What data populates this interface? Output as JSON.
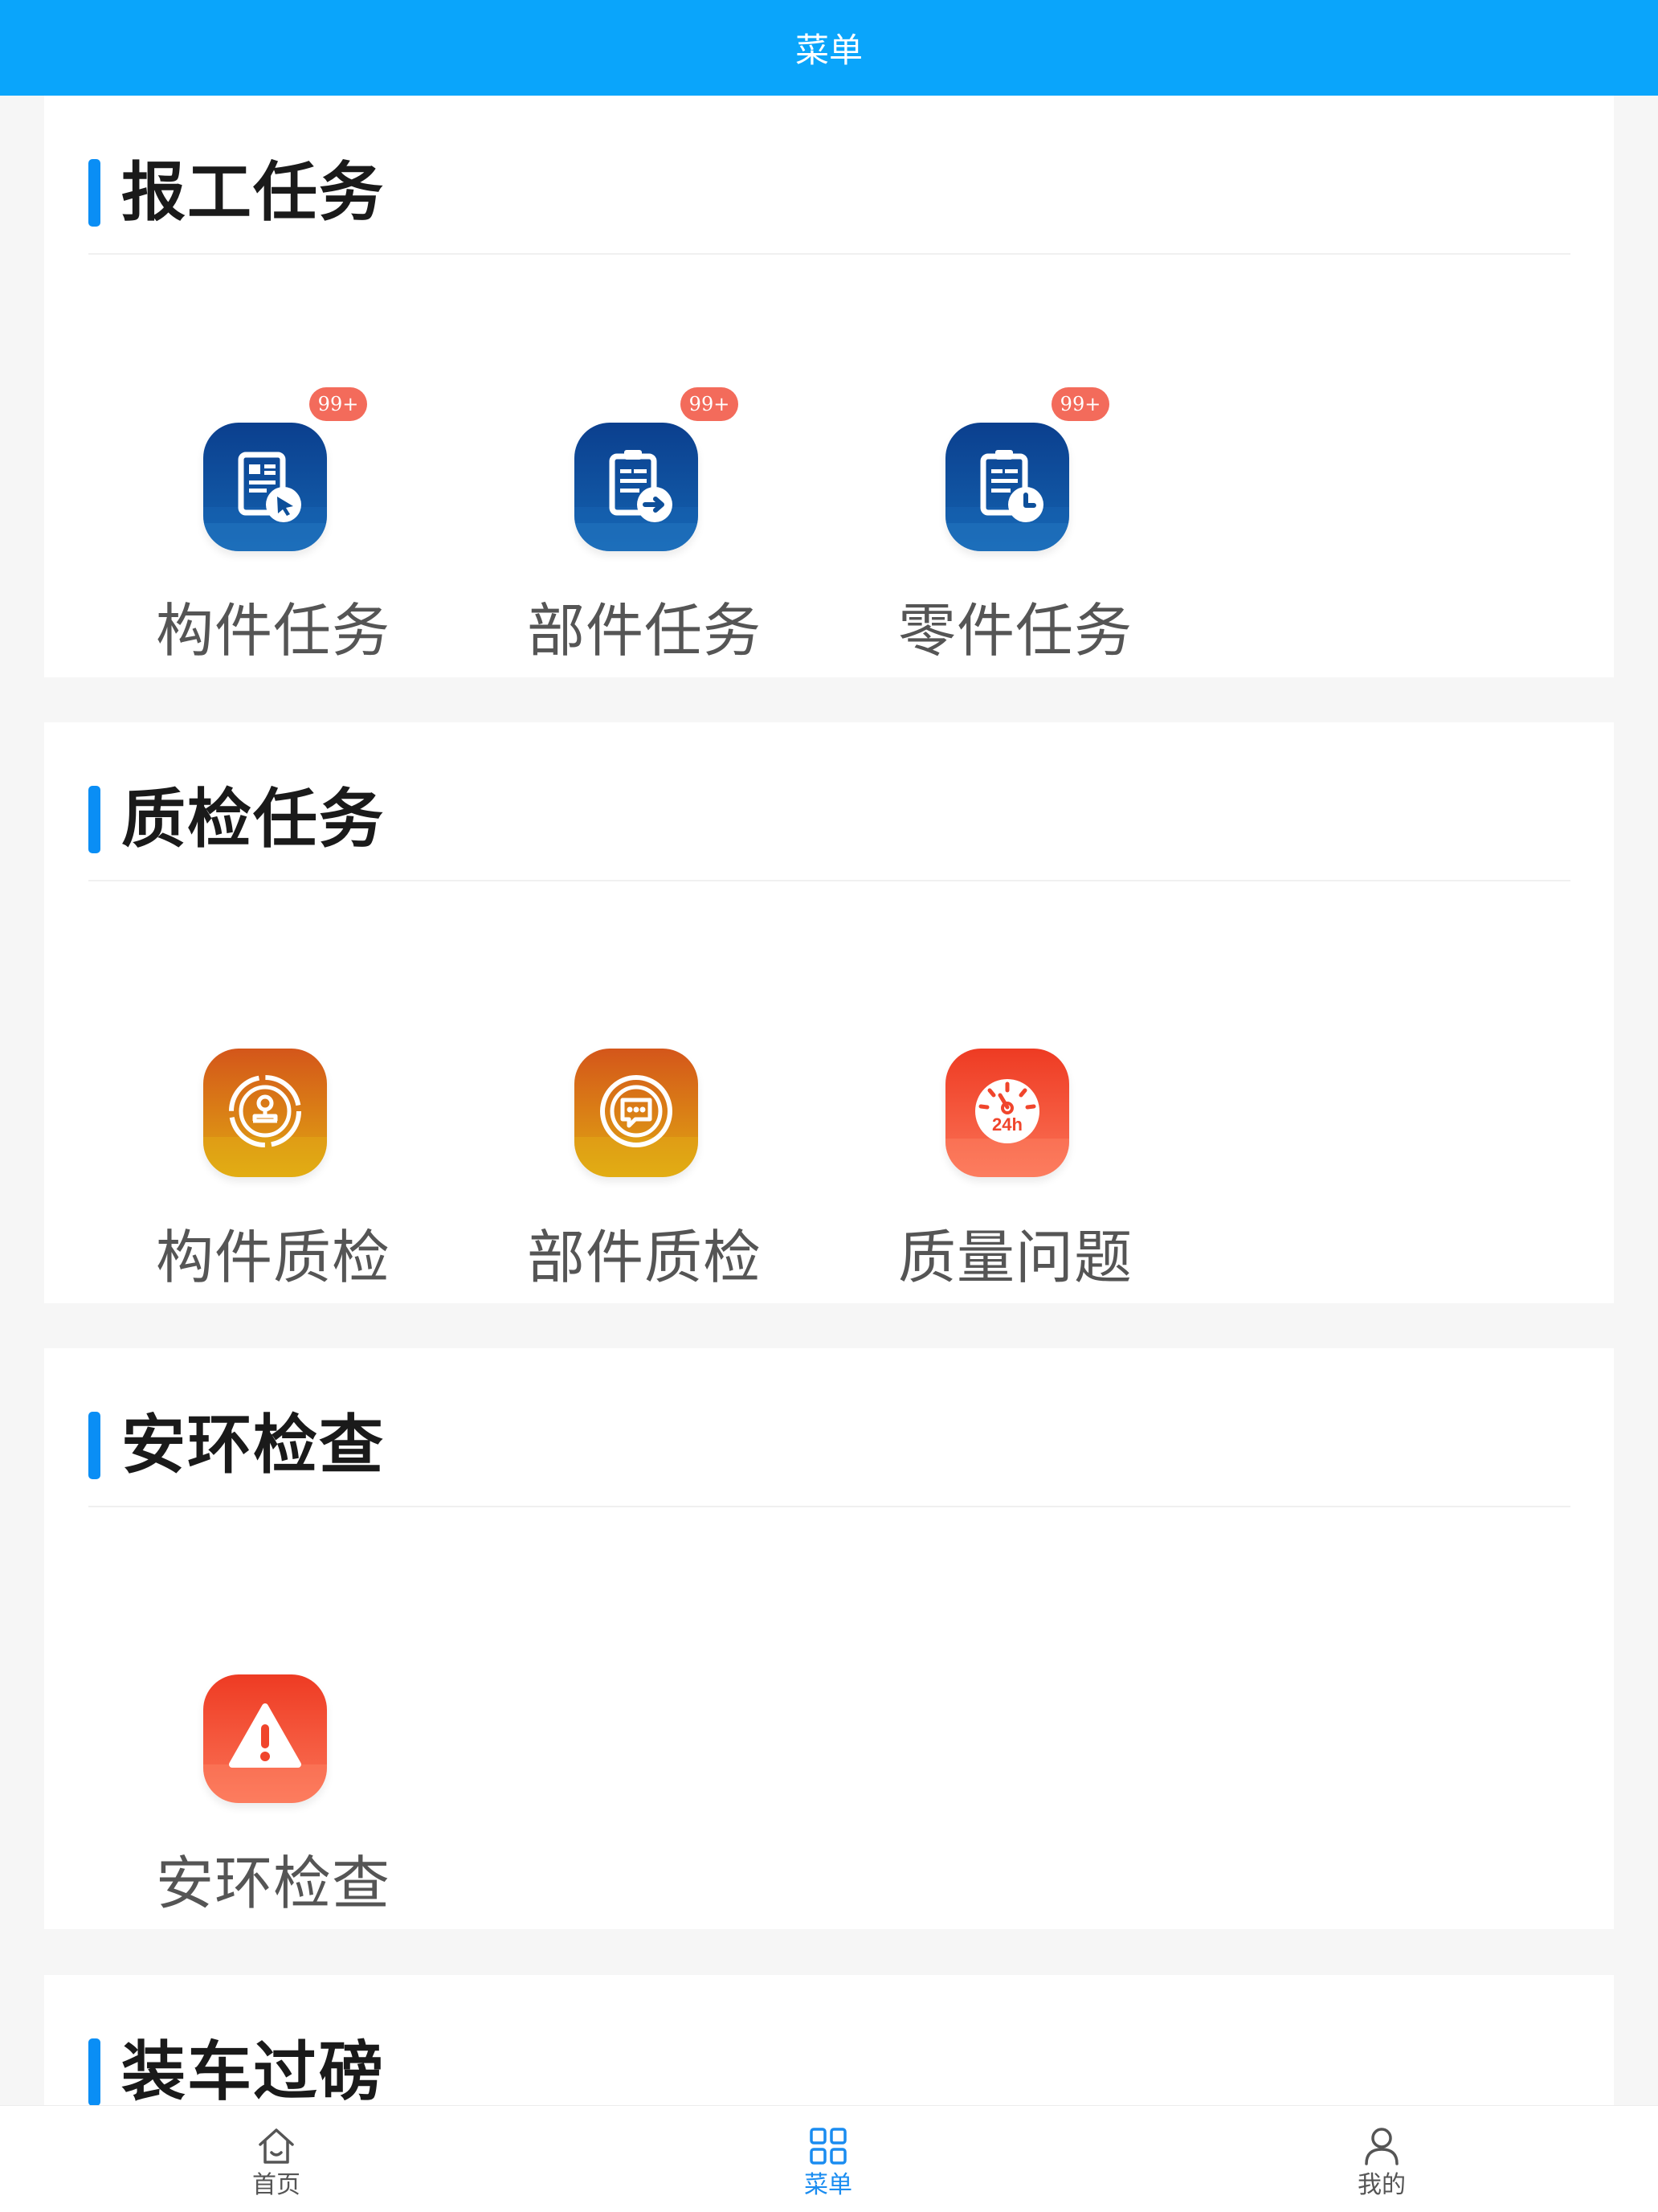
{
  "header": {
    "title": "菜单"
  },
  "sections": [
    {
      "title": "报工任务",
      "items": [
        {
          "label": "构件任务",
          "badge": "99+",
          "icon": "document-cursor-icon"
        },
        {
          "label": "部件任务",
          "badge": "99+",
          "icon": "clipboard-arrow-icon"
        },
        {
          "label": "零件任务",
          "badge": "99+",
          "icon": "clipboard-clock-icon"
        }
      ]
    },
    {
      "title": "质检任务",
      "items": [
        {
          "label": "构件质检",
          "icon": "inspector-seal-icon"
        },
        {
          "label": "部件质检",
          "icon": "message-bubble-icon"
        },
        {
          "label": "质量问题",
          "icon": "timer-24h-icon"
        }
      ]
    },
    {
      "title": "安环检查",
      "items": [
        {
          "label": "安环检查",
          "icon": "warning-triangle-icon"
        }
      ]
    },
    {
      "title": "装车过磅",
      "items": []
    }
  ],
  "tabbar": {
    "items": [
      {
        "label": "首页",
        "icon": "home-icon",
        "active": false
      },
      {
        "label": "菜单",
        "icon": "grid-icon",
        "active": true
      },
      {
        "label": "我的",
        "icon": "user-icon",
        "active": false
      }
    ]
  },
  "colors": {
    "header": "#0aa5fb",
    "accent": "#0a8ef5",
    "badge": "#f36b5b",
    "active_tab": "#1a8cf0",
    "blue_icon": "#0d4f9a",
    "amber_icon": "#d86a10",
    "red_icon": "#f0452c"
  }
}
